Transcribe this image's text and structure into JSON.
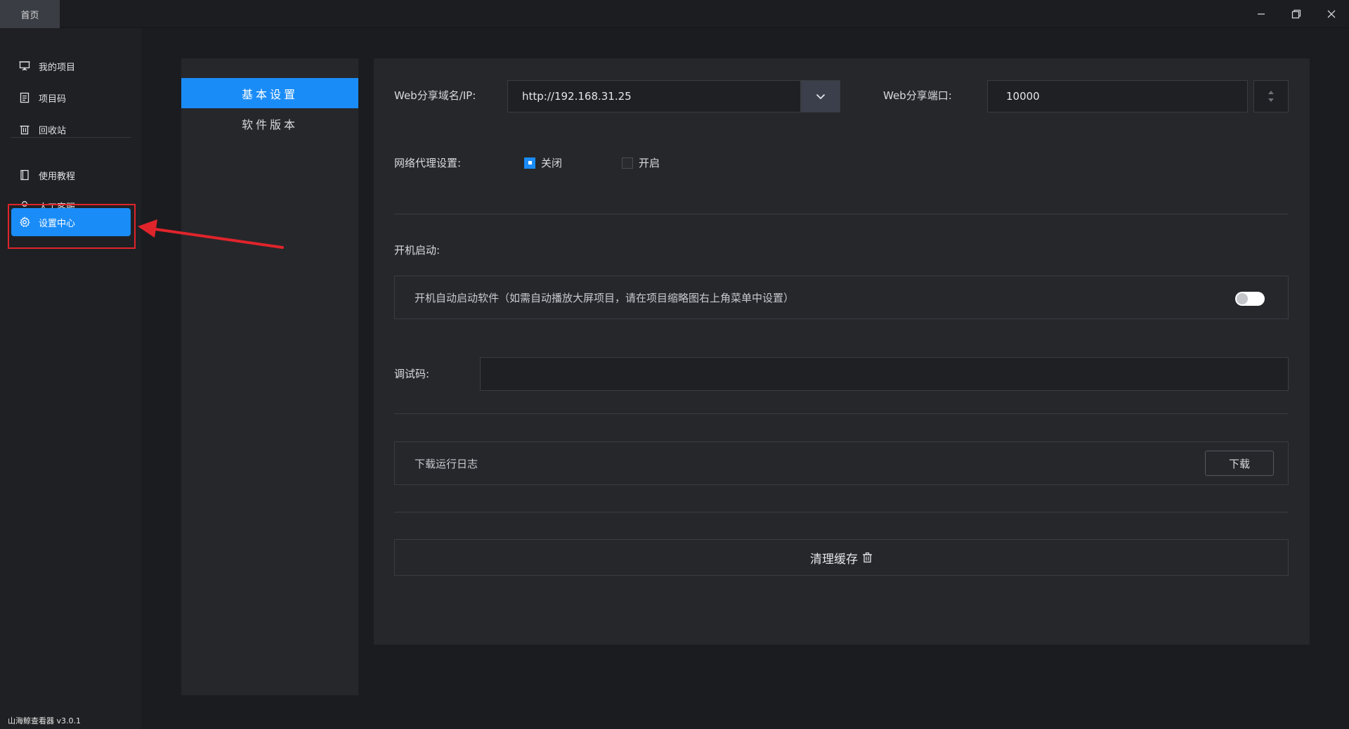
{
  "titlebar": {
    "tab_label": "首页"
  },
  "sidebar": {
    "items": [
      {
        "label": "我的项目",
        "icon": "presentation-board-icon"
      },
      {
        "label": "项目码",
        "icon": "document-icon"
      },
      {
        "label": "回收站",
        "icon": "trash-icon"
      },
      {
        "label": "使用教程",
        "icon": "book-icon"
      },
      {
        "label": "人工客服",
        "icon": "user-icon"
      },
      {
        "label": "设置中心",
        "icon": "gear-icon",
        "active": true
      }
    ],
    "version": "山海鲸查看器 v3.0.1"
  },
  "settings_nav": {
    "items": [
      {
        "label": "基本设置",
        "active": true
      },
      {
        "label": "软件版本",
        "active": false
      }
    ]
  },
  "settings": {
    "web_domain_label": "Web分享域名/IP:",
    "web_domain_value": "http://192.168.31.25",
    "web_port_label": "Web分享端口:",
    "web_port_value": "10000",
    "proxy_label": "网络代理设置:",
    "proxy_options": [
      {
        "label": "关闭",
        "checked": true
      },
      {
        "label": "开启",
        "checked": false
      }
    ],
    "autostart_label": "开机启动:",
    "autostart_text": "开机自动启动软件（如需自动播放大屏项目，请在项目缩略图右上角菜单中设置）",
    "autostart_enabled": false,
    "debug_label": "调试码:",
    "debug_value": "",
    "log_text": "下载运行日志",
    "log_button": "下载",
    "clear_cache_label": "清理缓存"
  },
  "colors": {
    "accent": "#1a8cf7",
    "annotation": "#e0242b"
  }
}
